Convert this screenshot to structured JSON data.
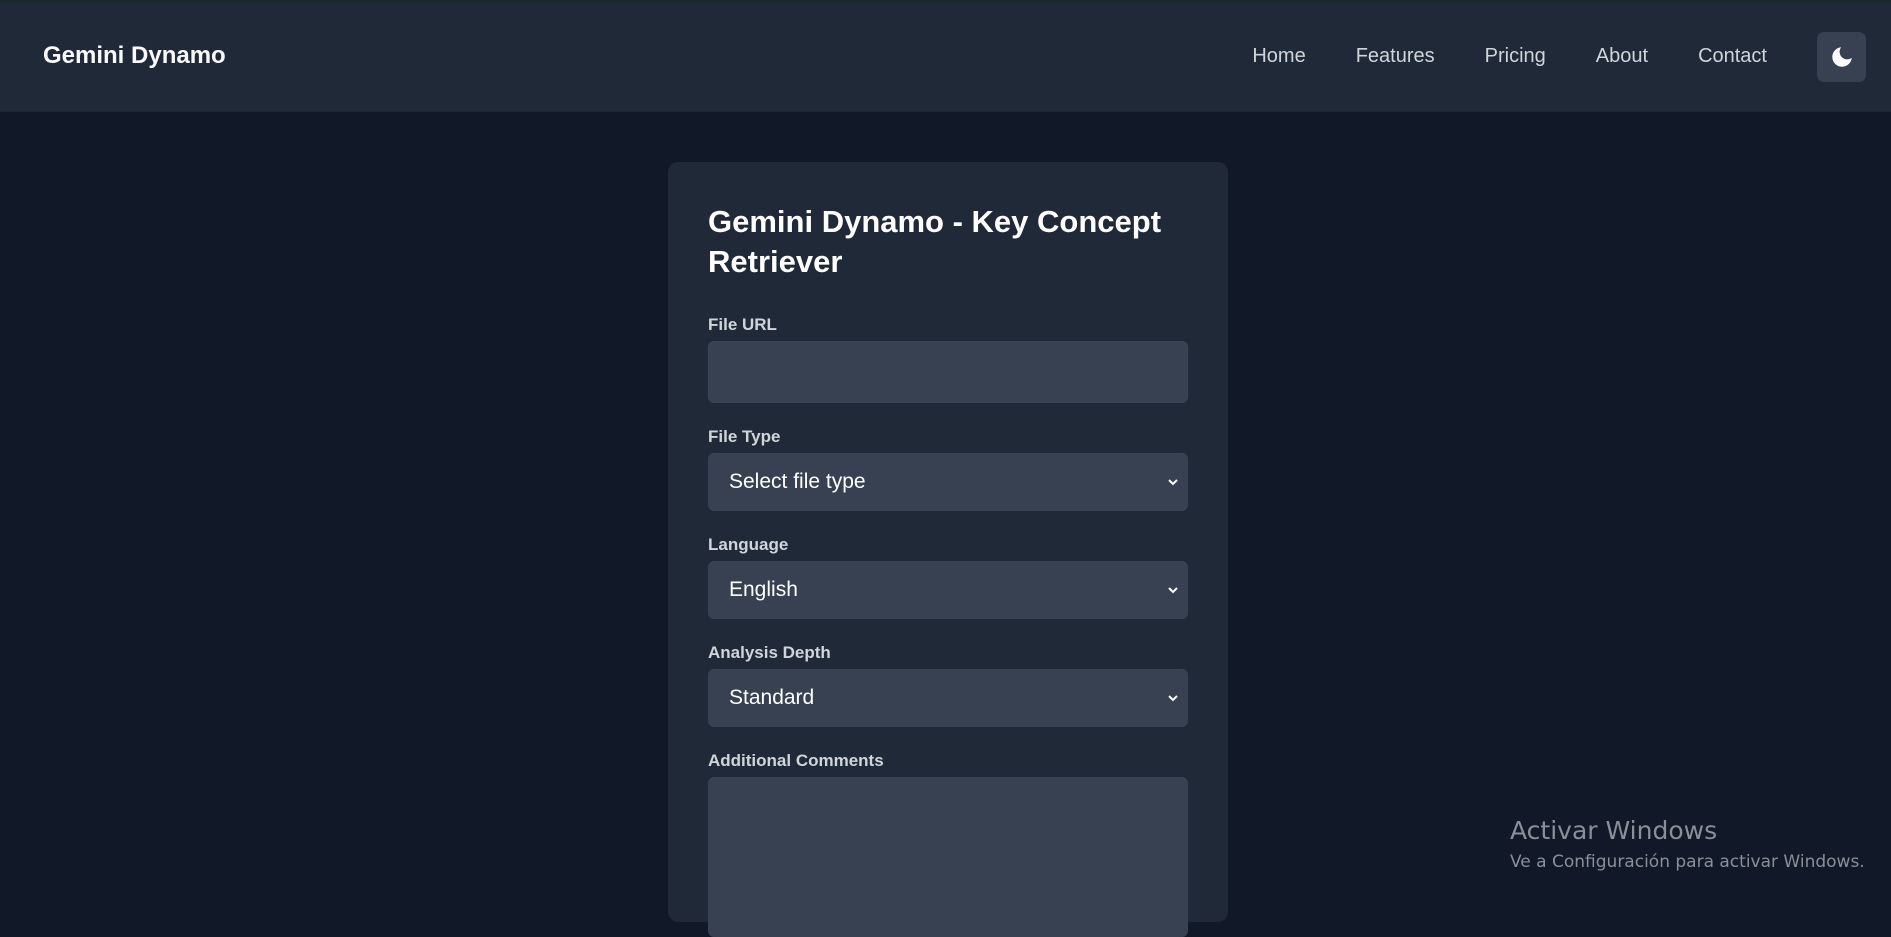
{
  "navbar": {
    "brand": "Gemini Dynamo",
    "links": [
      "Home",
      "Features",
      "Pricing",
      "About",
      "Contact"
    ],
    "theme_toggle_icon": "moon-icon"
  },
  "form": {
    "title": "Gemini Dynamo - Key Concept Retriever",
    "file_url": {
      "label": "File URL",
      "value": ""
    },
    "file_type": {
      "label": "File Type",
      "selected": "Select file type"
    },
    "language": {
      "label": "Language",
      "selected": "English"
    },
    "analysis_depth": {
      "label": "Analysis Depth",
      "selected": "Standard"
    },
    "additional_comments": {
      "label": "Additional Comments",
      "value": ""
    }
  },
  "watermark": {
    "title": "Activar Windows",
    "subtitle": "Ve a Configuración para activar Windows."
  },
  "colors": {
    "background": "#111827",
    "navbar": "#1f2937",
    "card": "#1f2937",
    "input": "#374151"
  }
}
